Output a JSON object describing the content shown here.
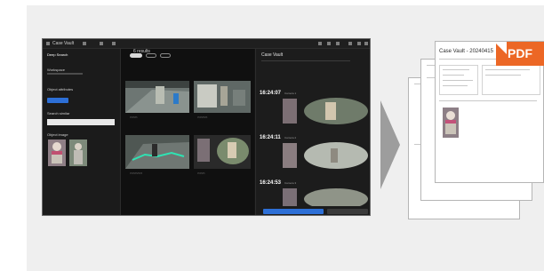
{
  "app": {
    "window_title": "Case Vault",
    "sidebar_heading": "Deep Search",
    "sidebar_sub1": "Workspace",
    "sidebar_sub2": "Object attributes",
    "sidebar_sub3": "Search similar",
    "sidebar_sub4": "Object image",
    "results_title": "6 results",
    "tabs": [
      "All",
      "Face",
      "Body"
    ],
    "panel_title": "Case Vault",
    "export_button": "Export",
    "timeline": [
      {
        "time": "16:24:07",
        "label": "Camera 1"
      },
      {
        "time": "16:24:11",
        "label": "Camera 2"
      },
      {
        "time": "16:24:53",
        "label": "Camera 3"
      }
    ]
  },
  "document": {
    "title": "Case Vault - 20240415",
    "badge": "PDF"
  },
  "colors": {
    "accent": "#2d6fd6",
    "pdf_badge": "#ec6725",
    "arrow": "#9d9d9d"
  }
}
